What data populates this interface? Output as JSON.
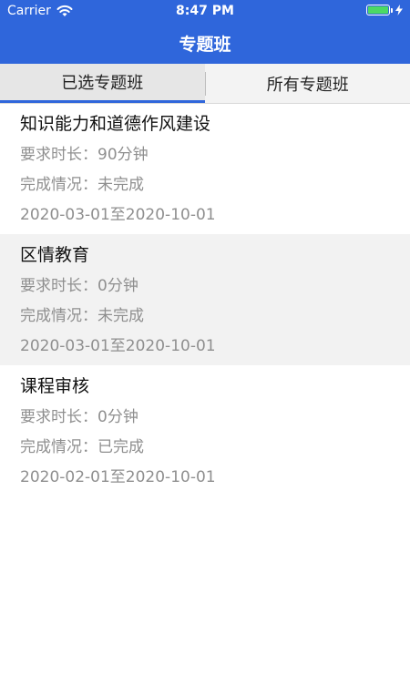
{
  "status_bar": {
    "carrier": "Carrier",
    "time": "8:47 PM"
  },
  "header": {
    "title": "专题班"
  },
  "tabs": [
    {
      "label": "已选专题班",
      "active": true
    },
    {
      "label": "所有专题班",
      "active": false
    }
  ],
  "courses": [
    {
      "title": "知识能力和道德作风建设",
      "duration": "要求时长：90分钟",
      "status": "完成情况：未完成",
      "date_range": "2020-03-01至2020-10-01"
    },
    {
      "title": "区情教育",
      "duration": "要求时长：0分钟",
      "status": "完成情况：未完成",
      "date_range": "2020-03-01至2020-10-01"
    },
    {
      "title": "课程审核",
      "duration": "要求时长：0分钟",
      "status": "完成情况：已完成",
      "date_range": "2020-02-01至2020-10-01"
    }
  ],
  "colors": {
    "header": "#2f66db",
    "tab_indicator": "#2f66db",
    "battery": "#4cd964",
    "secondary_text": "#8f8f8f"
  },
  "icons": {
    "wifi": "wifi-icon",
    "battery": "battery-icon",
    "charging": "bolt-icon"
  }
}
